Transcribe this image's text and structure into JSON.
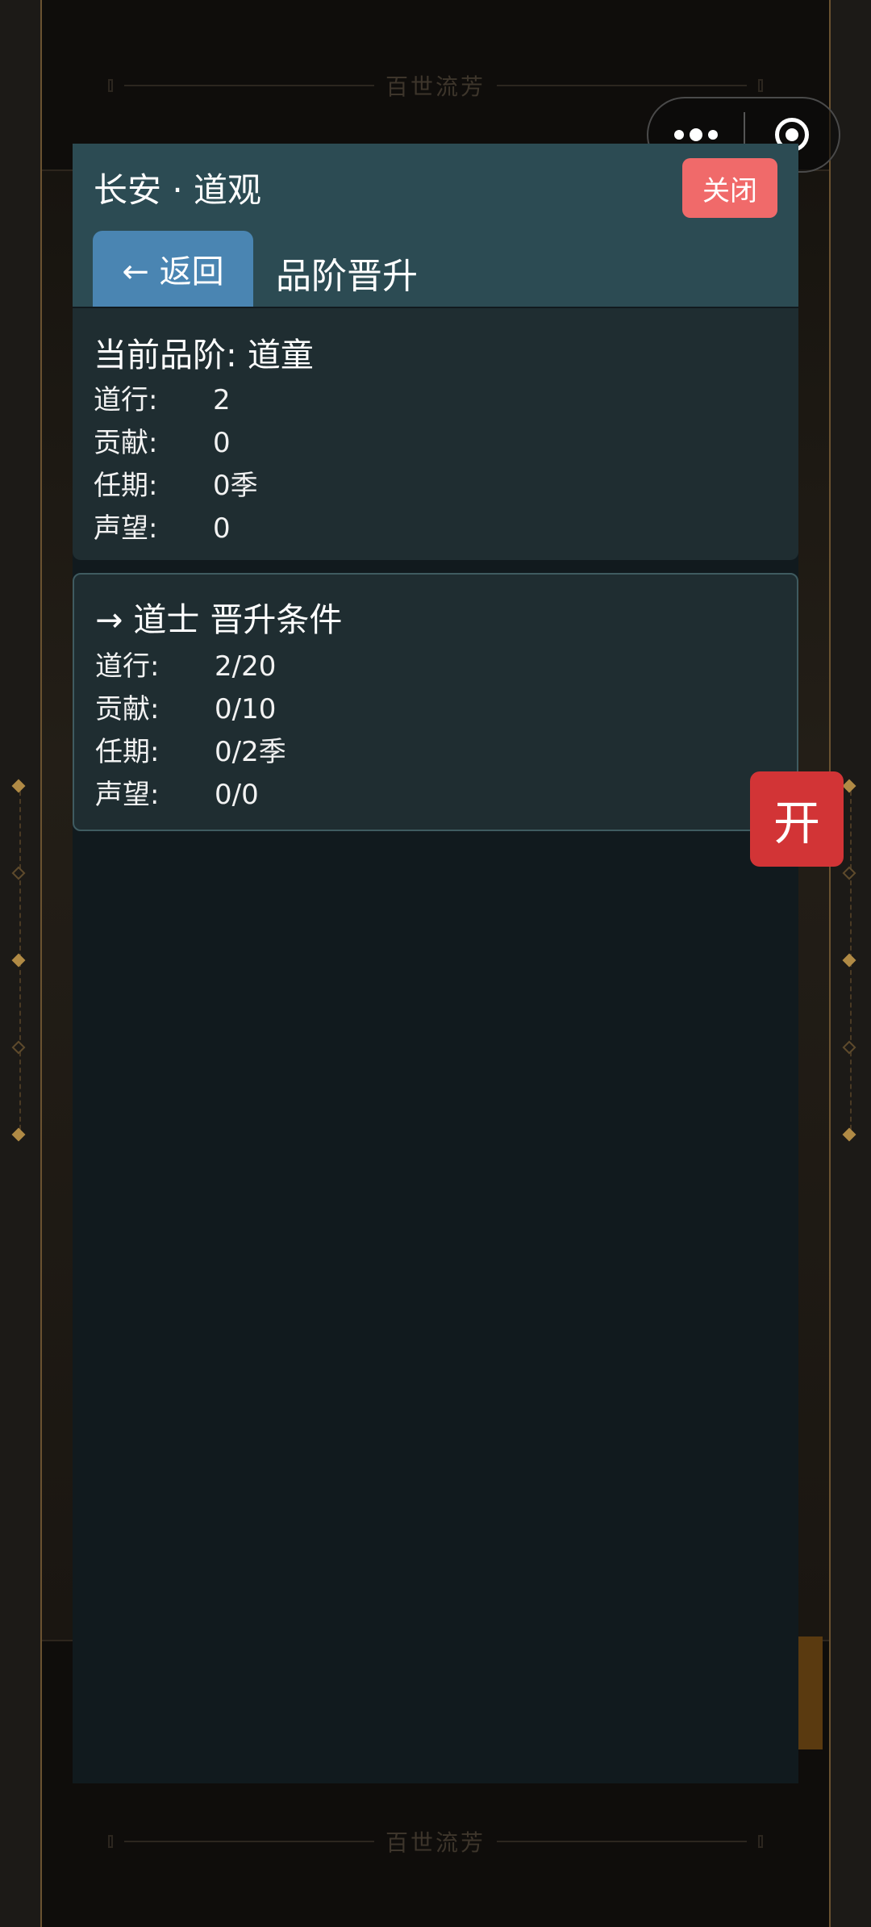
{
  "background": {
    "title_top": "百世流芳",
    "title_bottom": "百世流芳"
  },
  "capsule": {
    "more_icon": "more-dots-icon",
    "close_icon": "target-circle-icon"
  },
  "modal": {
    "location_title": "长安 · 道观",
    "close_label": "关闭",
    "back_label": "← 返回",
    "page_title": "品阶晋升",
    "current": {
      "title": "当前品阶:  道童",
      "rows": [
        {
          "label": "道行:",
          "value": "2"
        },
        {
          "label": "贡献:",
          "value": "0"
        },
        {
          "label": "任期:",
          "value": "0季"
        },
        {
          "label": "声望:",
          "value": "0"
        }
      ]
    },
    "next": {
      "title": "→ 道士 晋升条件",
      "rows": [
        {
          "label": "道行:",
          "value": "2/20"
        },
        {
          "label": "贡献:",
          "value": "0/10"
        },
        {
          "label": "任期:",
          "value": "0/2季"
        },
        {
          "label": "声望:",
          "value": "0/0"
        }
      ]
    }
  },
  "floating": {
    "open_label": "开"
  },
  "colors": {
    "header_bg": "#2c4b53",
    "close_button": "#f06a6a",
    "back_button": "#4a85b2",
    "open_button": "#d23436",
    "card_bg": "#1f2d31"
  }
}
